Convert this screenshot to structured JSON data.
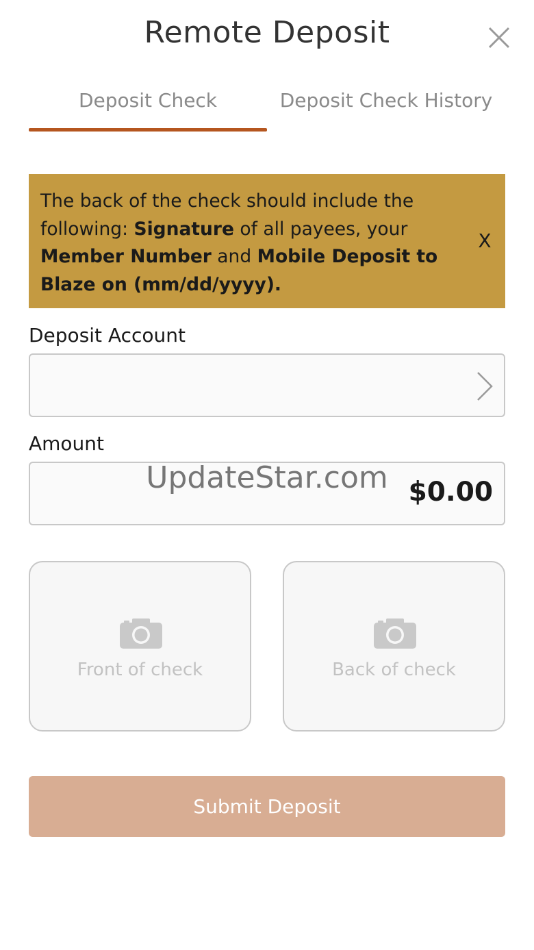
{
  "header": {
    "title": "Remote Deposit",
    "close_icon": "close-icon"
  },
  "tabs": [
    {
      "label": "Deposit Check",
      "active": true
    },
    {
      "label": "Deposit Check History",
      "active": false
    }
  ],
  "banner": {
    "text_1": "The back of the check should include the following: ",
    "bold_1": "Signature",
    "text_2": " of all payees, your ",
    "bold_2": "Member Number",
    "text_3": " and ",
    "bold_3": "Mobile Deposit to Blaze on (mm/dd/yyyy).",
    "dismiss_label": "X"
  },
  "form": {
    "account_label": "Deposit Account",
    "account_value": "",
    "amount_label": "Amount",
    "amount_value": "$0.00"
  },
  "watermark": "UpdateStar.com",
  "check_images": {
    "front_label": "Front of check",
    "back_label": "Back of check",
    "icon": "camera-icon"
  },
  "submit_label": "Submit Deposit",
  "colors": {
    "accent": "#b5561f",
    "banner": "#c49a41",
    "submit_disabled": "#d8ad93"
  }
}
